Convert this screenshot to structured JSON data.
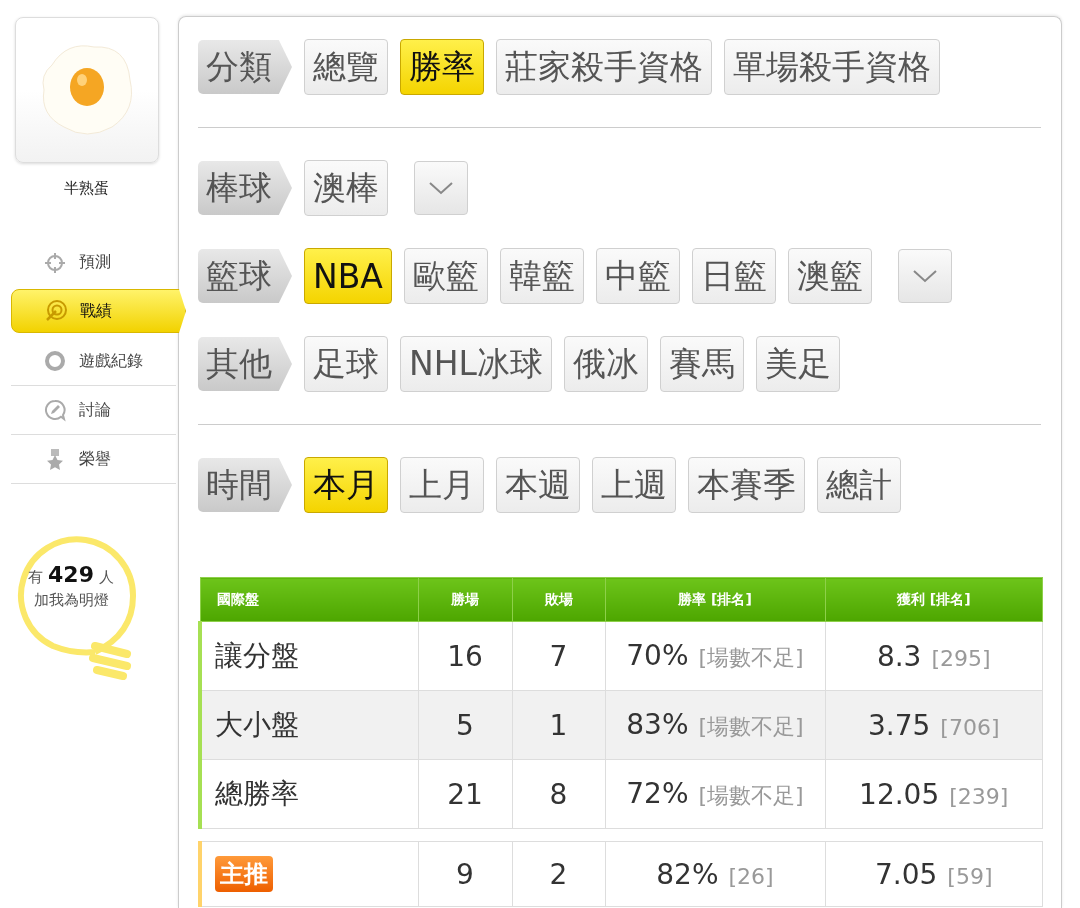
{
  "profile": {
    "name": "半熟蛋"
  },
  "nav": [
    {
      "label": "預測",
      "selected": false
    },
    {
      "label": "戰績",
      "selected": true
    },
    {
      "label": "遊戲紀錄",
      "selected": false
    },
    {
      "label": "討論",
      "selected": false
    },
    {
      "label": "榮譽",
      "selected": false
    }
  ],
  "fans": {
    "prefix": "有",
    "count": "429",
    "suffix": "人",
    "caption": "加我為明燈"
  },
  "filter_sections": [
    {
      "rows": [
        {
          "label": "分類",
          "has_dropdown": false,
          "options": [
            {
              "text": "總覽",
              "selected": false
            },
            {
              "text": "勝率",
              "selected": true
            },
            {
              "text": "莊家殺手資格",
              "selected": false
            },
            {
              "text": "單場殺手資格",
              "selected": false
            }
          ]
        }
      ]
    },
    {
      "rows": [
        {
          "label": "棒球",
          "has_dropdown": true,
          "options": [
            {
              "text": "澳棒",
              "selected": false
            }
          ]
        },
        {
          "label": "籃球",
          "has_dropdown": true,
          "options": [
            {
              "text": "NBA",
              "selected": true
            },
            {
              "text": "歐籃",
              "selected": false
            },
            {
              "text": "韓籃",
              "selected": false
            },
            {
              "text": "中籃",
              "selected": false
            },
            {
              "text": "日籃",
              "selected": false
            },
            {
              "text": "澳籃",
              "selected": false
            }
          ]
        },
        {
          "label": "其他",
          "has_dropdown": false,
          "options": [
            {
              "text": "足球",
              "selected": false
            },
            {
              "text": "NHL冰球",
              "selected": false
            },
            {
              "text": "俄冰",
              "selected": false
            },
            {
              "text": "賽馬",
              "selected": false
            },
            {
              "text": "美足",
              "selected": false
            }
          ]
        }
      ]
    },
    {
      "rows": [
        {
          "label": "時間",
          "has_dropdown": false,
          "options": [
            {
              "text": "本月",
              "selected": true
            },
            {
              "text": "上月",
              "selected": false
            },
            {
              "text": "本週",
              "selected": false
            },
            {
              "text": "上週",
              "selected": false
            },
            {
              "text": "本賽季",
              "selected": false
            },
            {
              "text": "總計",
              "selected": false
            }
          ]
        }
      ]
    }
  ],
  "table": {
    "columns": [
      "國際盤",
      "勝場",
      "敗場",
      "勝率 [排名]",
      "獲利 [排名]"
    ],
    "rows": [
      {
        "kind": "market",
        "name": "讓分盤",
        "wins": "16",
        "losses": "7",
        "rate": "70%",
        "rate_rank": "[場數不足]",
        "profit": "8.3",
        "profit_rank": "[295]"
      },
      {
        "kind": "market",
        "name": "大小盤",
        "wins": "5",
        "losses": "1",
        "rate": "83%",
        "rate_rank": "[場數不足]",
        "profit": "3.75",
        "profit_rank": "[706]"
      },
      {
        "kind": "market",
        "name": "總勝率",
        "wins": "21",
        "losses": "8",
        "rate": "72%",
        "rate_rank": "[場數不足]",
        "profit": "12.05",
        "profit_rank": "[239]"
      },
      {
        "kind": "featured",
        "name": "主推",
        "wins": "9",
        "losses": "2",
        "rate": "82%",
        "rate_rank": "[26]",
        "profit": "7.05",
        "profit_rank": "[59]"
      }
    ]
  }
}
